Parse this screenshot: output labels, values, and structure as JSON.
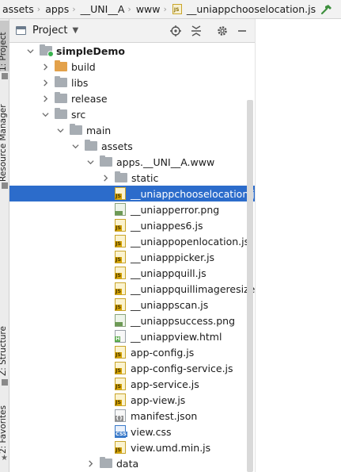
{
  "breadcrumbs": [
    {
      "label": "assets",
      "icon": "folder-icon"
    },
    {
      "label": "apps",
      "icon": "folder-icon"
    },
    {
      "label": "__UNI__A",
      "icon": "folder-icon"
    },
    {
      "label": "www",
      "icon": "folder-icon"
    },
    {
      "label": "__uniappchooselocation.js",
      "icon": "js-file-icon"
    }
  ],
  "file_tag_js": "JS",
  "tool_stripe": {
    "project": "1: Project",
    "resource_manager": "Resource Manager",
    "structure": "Z: Structure",
    "favorites": "2: Favorites"
  },
  "project_panel": {
    "title": "Project",
    "icons": [
      "locate-icon",
      "collapse-icon",
      "settings-icon",
      "hide-icon"
    ]
  },
  "tree": [
    {
      "label": "simpleDemo",
      "depth": 0,
      "type": "module",
      "expanded": true,
      "bold": true
    },
    {
      "label": "build",
      "depth": 1,
      "type": "folder-orange",
      "expanded": false
    },
    {
      "label": "libs",
      "depth": 1,
      "type": "folder",
      "expanded": false
    },
    {
      "label": "release",
      "depth": 1,
      "type": "folder",
      "expanded": false
    },
    {
      "label": "src",
      "depth": 1,
      "type": "folder",
      "expanded": true
    },
    {
      "label": "main",
      "depth": 2,
      "type": "folder",
      "expanded": true
    },
    {
      "label": "assets",
      "depth": 3,
      "type": "folder",
      "expanded": true
    },
    {
      "label": "apps.__UNI__A.www",
      "depth": 4,
      "type": "folder",
      "expanded": true
    },
    {
      "label": "static",
      "depth": 5,
      "type": "folder",
      "expanded": false
    },
    {
      "label": "__uniappchooselocation.js",
      "depth": 5,
      "type": "js",
      "selected": true
    },
    {
      "label": "__uniapperror.png",
      "depth": 5,
      "type": "png"
    },
    {
      "label": "__uniappes6.js",
      "depth": 5,
      "type": "js"
    },
    {
      "label": "__uniappopenlocation.js",
      "depth": 5,
      "type": "js"
    },
    {
      "label": "__uniapppicker.js",
      "depth": 5,
      "type": "js"
    },
    {
      "label": "__uniappquill.js",
      "depth": 5,
      "type": "js"
    },
    {
      "label": "__uniappquillimageresize.js",
      "depth": 5,
      "type": "js"
    },
    {
      "label": "__uniappscan.js",
      "depth": 5,
      "type": "js"
    },
    {
      "label": "__uniappsuccess.png",
      "depth": 5,
      "type": "png"
    },
    {
      "label": "__uniappview.html",
      "depth": 5,
      "type": "html"
    },
    {
      "label": "app-config.js",
      "depth": 5,
      "type": "js"
    },
    {
      "label": "app-config-service.js",
      "depth": 5,
      "type": "js"
    },
    {
      "label": "app-service.js",
      "depth": 5,
      "type": "js"
    },
    {
      "label": "app-view.js",
      "depth": 5,
      "type": "js"
    },
    {
      "label": "manifest.json",
      "depth": 5,
      "type": "json"
    },
    {
      "label": "view.css",
      "depth": 5,
      "type": "css"
    },
    {
      "label": "view.umd.min.js",
      "depth": 5,
      "type": "js"
    },
    {
      "label": "data",
      "depth": 4,
      "type": "folder",
      "expanded": false
    }
  ],
  "colors": {
    "selection": "#2c6ccb",
    "folder": "#a7adb3",
    "build_folder": "#e3a14a",
    "js_icon": "#d7a400"
  }
}
